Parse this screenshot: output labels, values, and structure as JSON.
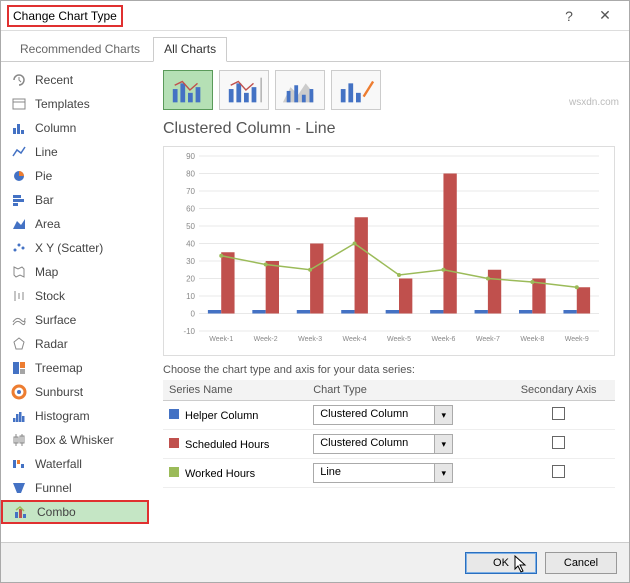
{
  "window": {
    "title": "Change Chart Type"
  },
  "tabs": {
    "recommended": "Recommended Charts",
    "all": "All Charts"
  },
  "sidebar": {
    "items": [
      {
        "label": "Recent"
      },
      {
        "label": "Templates"
      },
      {
        "label": "Column"
      },
      {
        "label": "Line"
      },
      {
        "label": "Pie"
      },
      {
        "label": "Bar"
      },
      {
        "label": "Area"
      },
      {
        "label": "X Y (Scatter)"
      },
      {
        "label": "Map"
      },
      {
        "label": "Stock"
      },
      {
        "label": "Surface"
      },
      {
        "label": "Radar"
      },
      {
        "label": "Treemap"
      },
      {
        "label": "Sunburst"
      },
      {
        "label": "Histogram"
      },
      {
        "label": "Box & Whisker"
      },
      {
        "label": "Waterfall"
      },
      {
        "label": "Funnel"
      },
      {
        "label": "Combo"
      }
    ]
  },
  "chart": {
    "subtype_title": "Clustered Column - Line"
  },
  "chart_data": {
    "type": "bar",
    "categories": [
      "Week-1",
      "Week-2",
      "Week-3",
      "Week-4",
      "Week-5",
      "Week-6",
      "Week-7",
      "Week-8",
      "Week-9"
    ],
    "series": [
      {
        "name": "Helper Column",
        "type": "bar",
        "color": "#4472c4",
        "values": [
          2,
          2,
          2,
          2,
          2,
          2,
          2,
          2,
          2
        ]
      },
      {
        "name": "Scheduled Hours",
        "type": "bar",
        "color": "#c0504d",
        "values": [
          35,
          30,
          40,
          55,
          20,
          80,
          25,
          20,
          15
        ]
      },
      {
        "name": "Worked Hours",
        "type": "line",
        "color": "#9bbb59",
        "values": [
          33,
          28,
          25,
          40,
          22,
          25,
          20,
          18,
          15
        ]
      }
    ],
    "ylim": [
      -10,
      90
    ],
    "yticks": [
      -10,
      0,
      10,
      20,
      30,
      40,
      50,
      60,
      70,
      80,
      90
    ],
    "xlabel": "",
    "ylabel": "",
    "title": ""
  },
  "series_config": {
    "instruction": "Choose the chart type and axis for your data series:",
    "headers": {
      "name": "Series Name",
      "type": "Chart Type",
      "secondary": "Secondary Axis"
    },
    "rows": [
      {
        "name": "Helper Column",
        "color": "#4472c4",
        "type": "Clustered Column",
        "secondary": false
      },
      {
        "name": "Scheduled Hours",
        "color": "#c0504d",
        "type": "Clustered Column",
        "secondary": false
      },
      {
        "name": "Worked Hours",
        "color": "#9bbb59",
        "type": "Line",
        "secondary": false
      }
    ]
  },
  "buttons": {
    "ok": "OK",
    "cancel": "Cancel"
  },
  "watermark": "wsxdn.com"
}
